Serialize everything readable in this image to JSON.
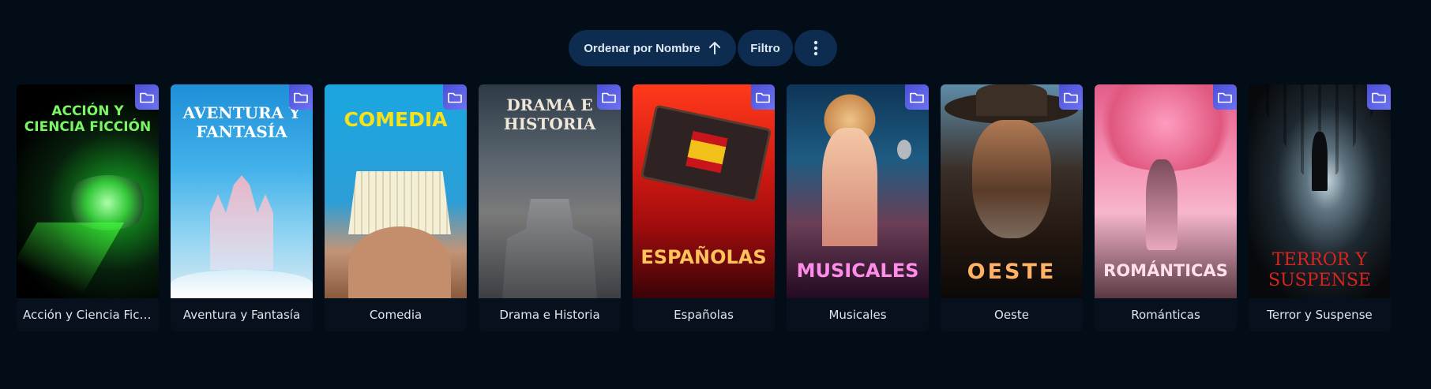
{
  "toolbar": {
    "sort_label": "Ordenar por Nombre",
    "filter_label": "Filtro"
  },
  "colors": {
    "background": "#030d18",
    "button_bg": "#0d2c4f",
    "folder_badge": "#5a5fe6"
  },
  "collections": [
    {
      "label": "Acción y Ciencia Ficc…",
      "poster_text": "ACCIÓN Y\nCIENCIA FICCIÓN",
      "poster_text_color": "#7cf564",
      "icon": "folder-icon"
    },
    {
      "label": "Aventura y Fantasía",
      "poster_text": "AVENTURA Y\nFANTASÍA",
      "poster_text_color": "#ffffff",
      "icon": "folder-icon"
    },
    {
      "label": "Comedia",
      "poster_text": "COMEDIA",
      "poster_text_color": "#f5e21a",
      "icon": "folder-icon"
    },
    {
      "label": "Drama e Historia",
      "poster_text": "DRAMA E\nHISTORIA",
      "poster_text_color": "#efe7d8",
      "icon": "folder-icon"
    },
    {
      "label": "Españolas",
      "poster_text": "ESPAÑOLAS",
      "poster_text_color": "#ffc35a",
      "icon": "folder-icon"
    },
    {
      "label": "Musicales",
      "poster_text": "MUSICALES",
      "poster_text_color": "#ff8ce8",
      "icon": "folder-icon"
    },
    {
      "label": "Oeste",
      "poster_text": "OESTE",
      "poster_text_color": "#ffb265",
      "icon": "folder-icon"
    },
    {
      "label": "Románticas",
      "poster_text": "ROMÁNTICAS",
      "poster_text_color": "#ffe0ea",
      "icon": "folder-icon"
    },
    {
      "label": "Terror y Suspense",
      "poster_text": "TERROR Y\nSUSPENSE",
      "poster_text_color": "#d8241d",
      "icon": "folder-icon"
    }
  ]
}
